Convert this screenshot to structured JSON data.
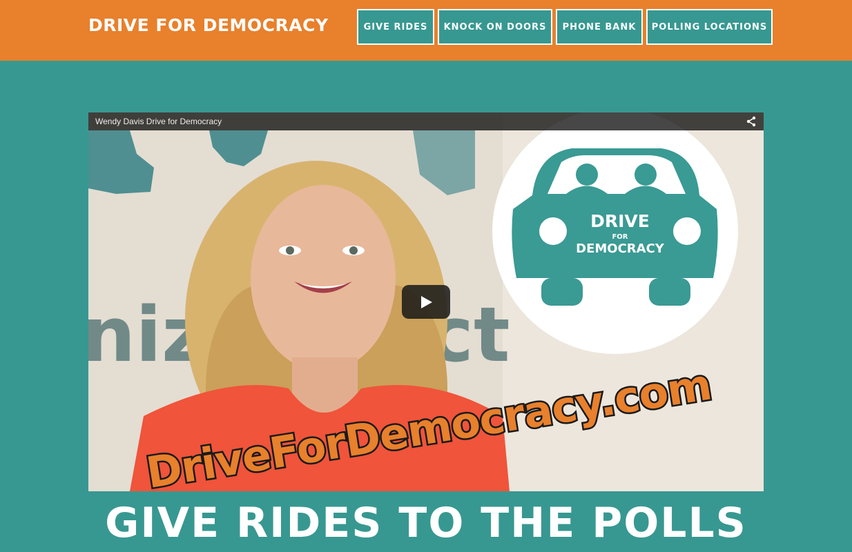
{
  "header": {
    "brand": "DRIVE FOR DEMOCRACY",
    "nav": [
      {
        "label": "GIVE RIDES"
      },
      {
        "label": "KNOCK ON DOORS"
      },
      {
        "label": "PHONE BANK"
      },
      {
        "label": "POLLING LOCATIONS"
      }
    ]
  },
  "video": {
    "title": "Wendy Davis Drive for Democracy",
    "logo_top": "DRIVE",
    "logo_mid": "FOR",
    "logo_bottom": "DEMOCRACY",
    "banner": "DriveForDemocracy.com",
    "backdrop_text": "nizProject",
    "share_icon": "share-icon",
    "play_icon": "play-icon"
  },
  "main": {
    "headline": "GIVE RIDES TO THE POLLS"
  },
  "colors": {
    "orange": "#e8802c",
    "teal": "#379891",
    "white": "#ffffff"
  }
}
